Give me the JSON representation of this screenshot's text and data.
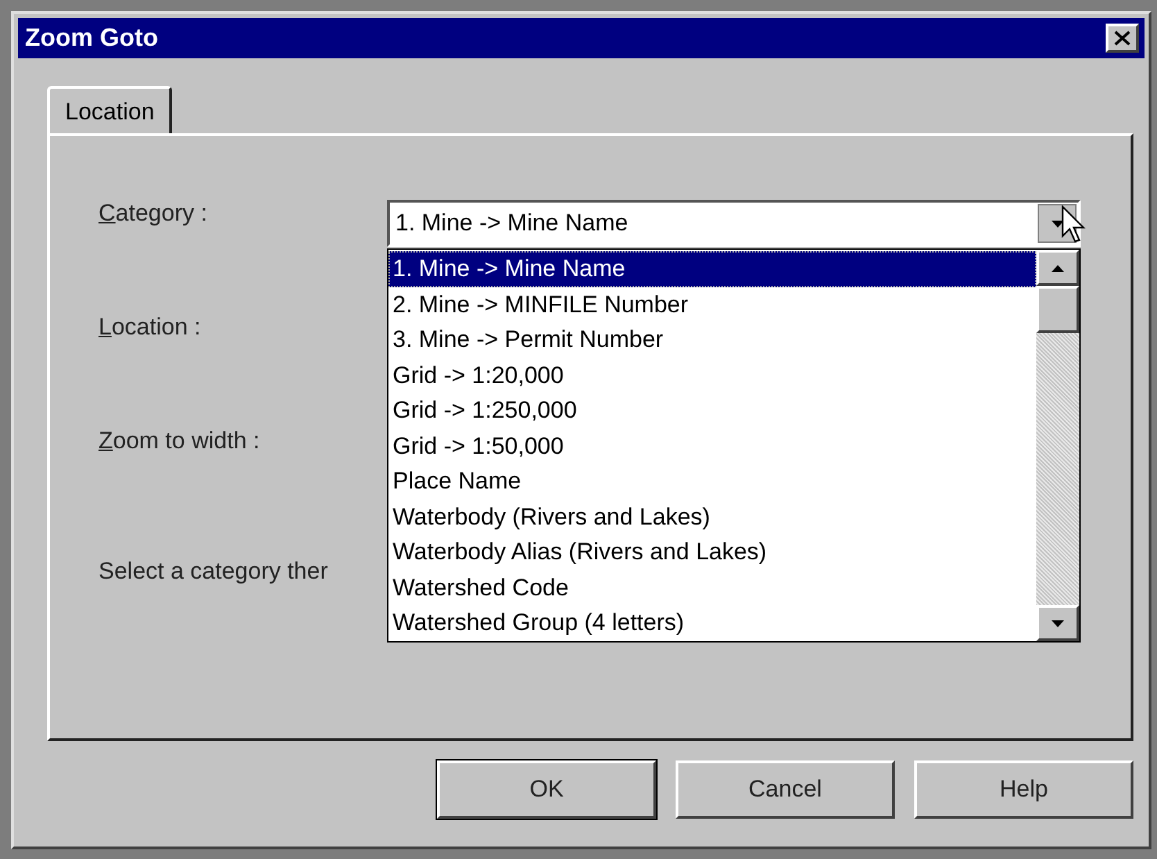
{
  "window": {
    "title": "Zoom Goto"
  },
  "tabs": [
    {
      "label": "Location",
      "selected": true
    }
  ],
  "fields": [
    {
      "label": "Category :"
    },
    {
      "label": "Location :"
    },
    {
      "label": "Zoom to width :"
    }
  ],
  "hint": "Select a category ther",
  "category": {
    "value": "1. Mine -> Mine Name",
    "expanded": true,
    "options": [
      {
        "label": "1. Mine -> Mine Name",
        "selected": true
      },
      {
        "label": "2. Mine -> MINFILE Number",
        "selected": false
      },
      {
        "label": "3. Mine -> Permit Number",
        "selected": false
      },
      {
        "label": "Grid -> 1:20,000",
        "selected": false
      },
      {
        "label": "Grid -> 1:250,000",
        "selected": false
      },
      {
        "label": "Grid -> 1:50,000",
        "selected": false
      },
      {
        "label": "Place Name",
        "selected": false
      },
      {
        "label": "Waterbody (Rivers and Lakes)",
        "selected": false
      },
      {
        "label": "Waterbody Alias (Rivers and Lakes)",
        "selected": false
      },
      {
        "label": "Watershed Code",
        "selected": false
      },
      {
        "label": "Watershed Group (4 letters)",
        "selected": false
      }
    ]
  },
  "buttons": [
    "OK",
    "Cancel",
    "Help"
  ]
}
